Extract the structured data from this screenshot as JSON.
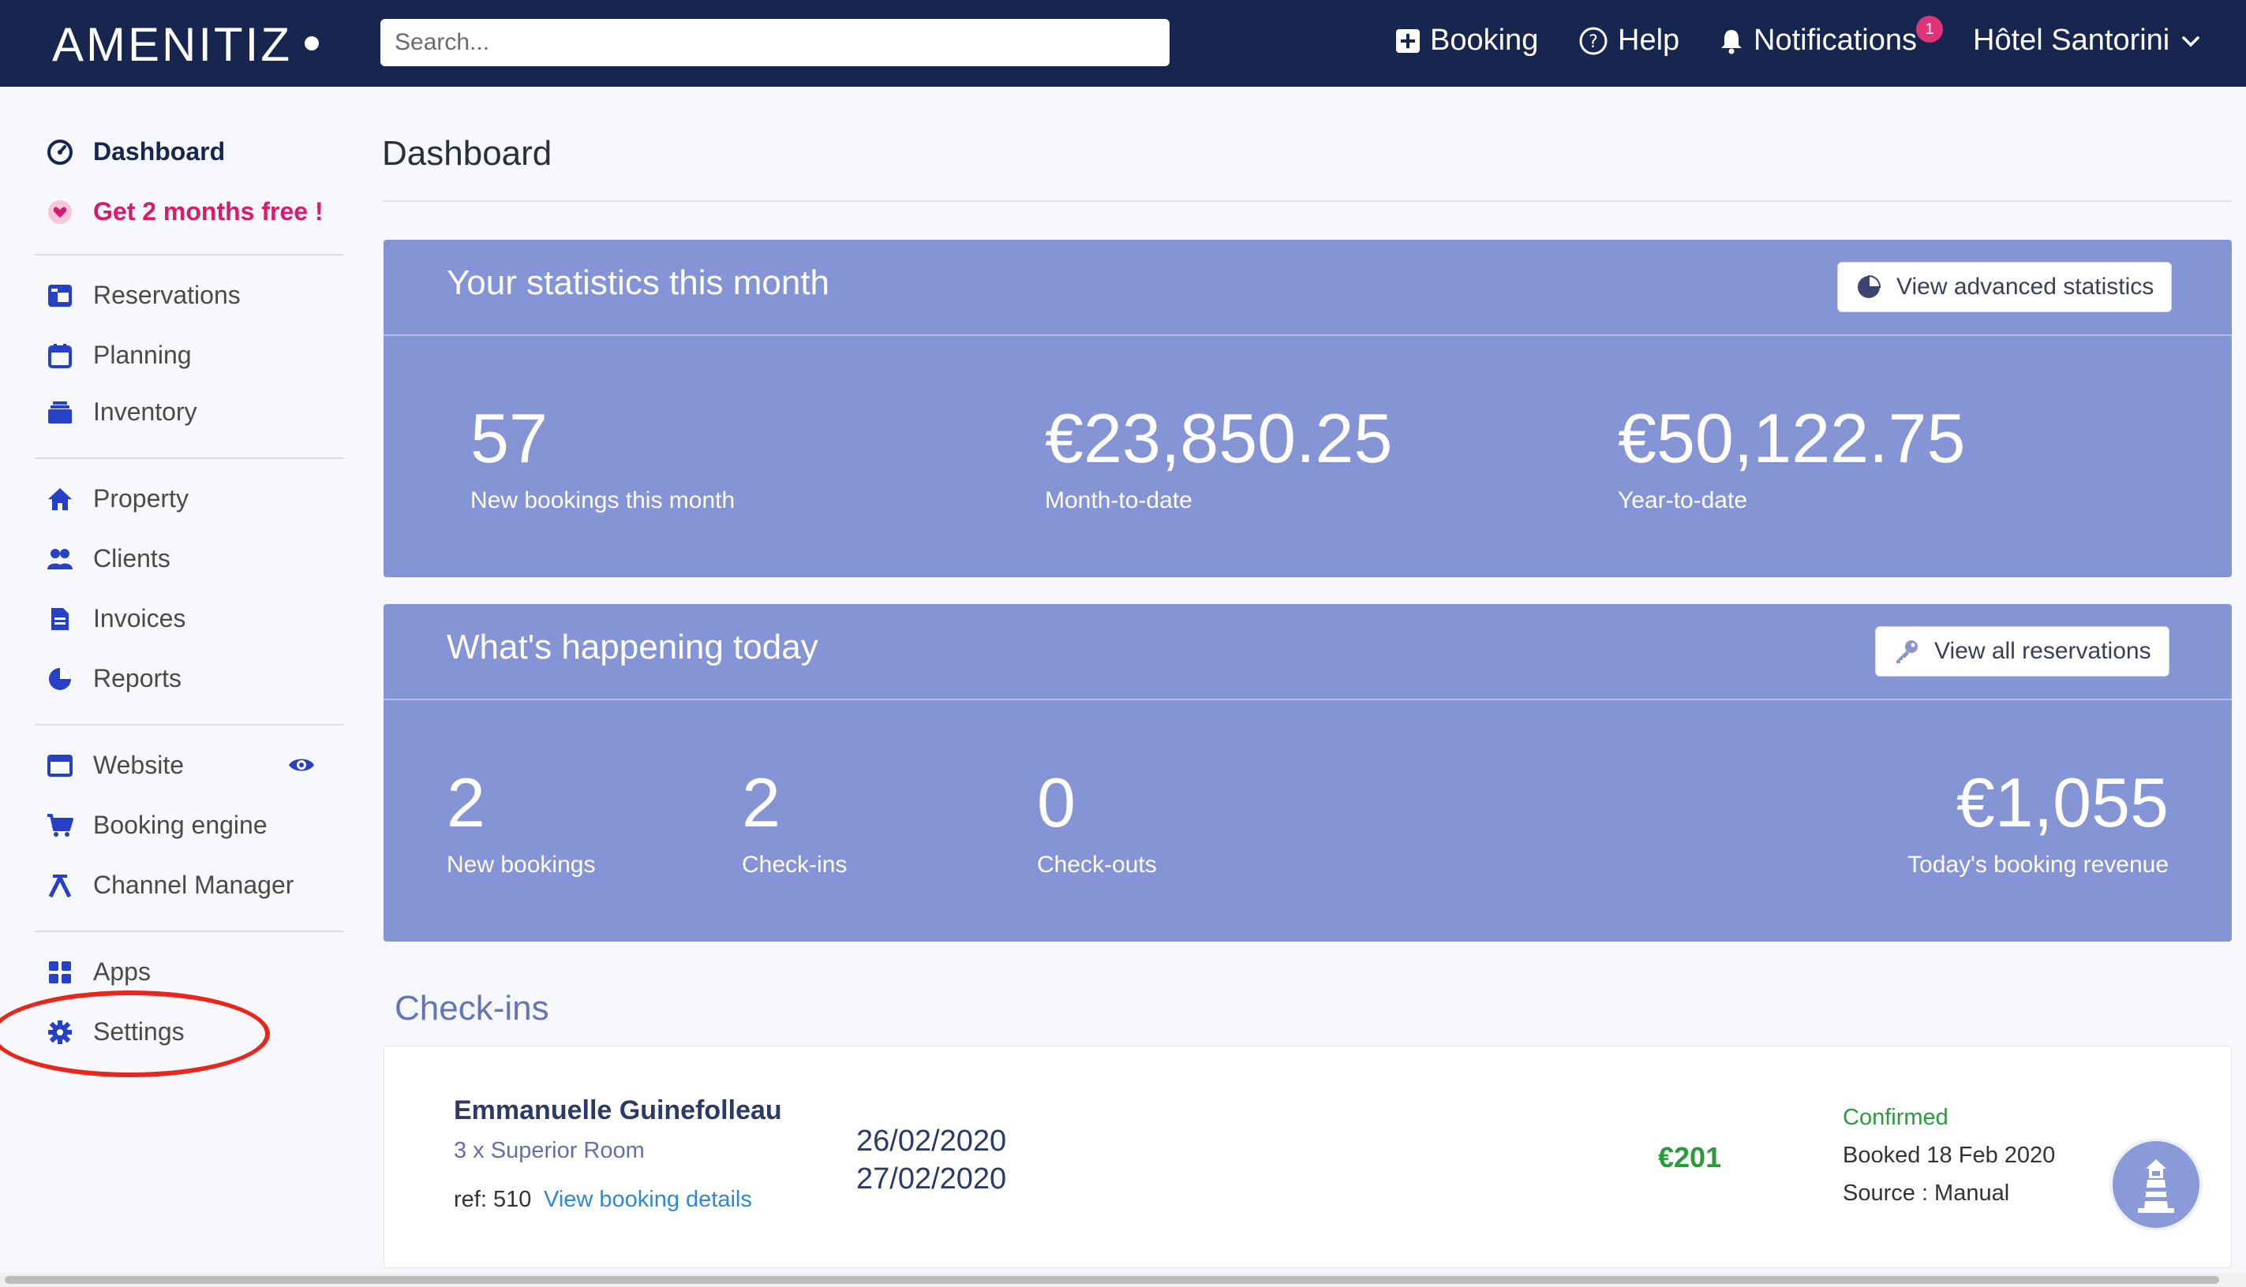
{
  "topbar": {
    "brand": "AMENITIZ",
    "search_placeholder": "Search...",
    "booking_label": "Booking",
    "help_label": "Help",
    "notifications_label": "Notifications",
    "notifications_count": "1",
    "hotel_name": "Hôtel Santorini"
  },
  "sidebar": {
    "dashboard": "Dashboard",
    "promo": "Get 2 months free !",
    "reservations": "Reservations",
    "planning": "Planning",
    "inventory": "Inventory",
    "property": "Property",
    "clients": "Clients",
    "invoices": "Invoices",
    "reports": "Reports",
    "website": "Website",
    "booking_engine": "Booking engine",
    "channel_manager": "Channel Manager",
    "apps": "Apps",
    "settings": "Settings"
  },
  "main": {
    "title": "Dashboard",
    "month_stats": {
      "title": "Your statistics this month",
      "button": "View advanced statistics",
      "bookings_value": "57",
      "bookings_label": "New bookings this month",
      "mtd_value": "€23,850.25",
      "mtd_label": "Month-to-date",
      "ytd_value": "€50,122.75",
      "ytd_label": "Year-to-date"
    },
    "today": {
      "title": "What's happening today",
      "button": "View all reservations",
      "new_bookings_value": "2",
      "new_bookings_label": "New bookings",
      "checkins_value": "2",
      "checkins_label": "Check-ins",
      "checkouts_value": "0",
      "checkouts_label": "Check-outs",
      "revenue_value": "€1,055",
      "revenue_label": "Today's booking revenue"
    },
    "checkins_title": "Check-ins",
    "checkin_row": {
      "guest": "Emmanuelle Guinefolleau",
      "room": "3 x Superior Room",
      "ref": "ref: 510",
      "details_link": "View booking details",
      "arrival": "26/02/2020",
      "departure": "27/02/2020",
      "amount": "€201",
      "status": "Confirmed",
      "booked": "Booked 18 Feb 2020",
      "source": "Source : Manual"
    }
  },
  "colors": {
    "topbar": "#16264f",
    "stat_card": "#8494d5",
    "promo": "#d81b6a",
    "confirmed": "#2a9a3c",
    "annotation": "#e8261b"
  }
}
